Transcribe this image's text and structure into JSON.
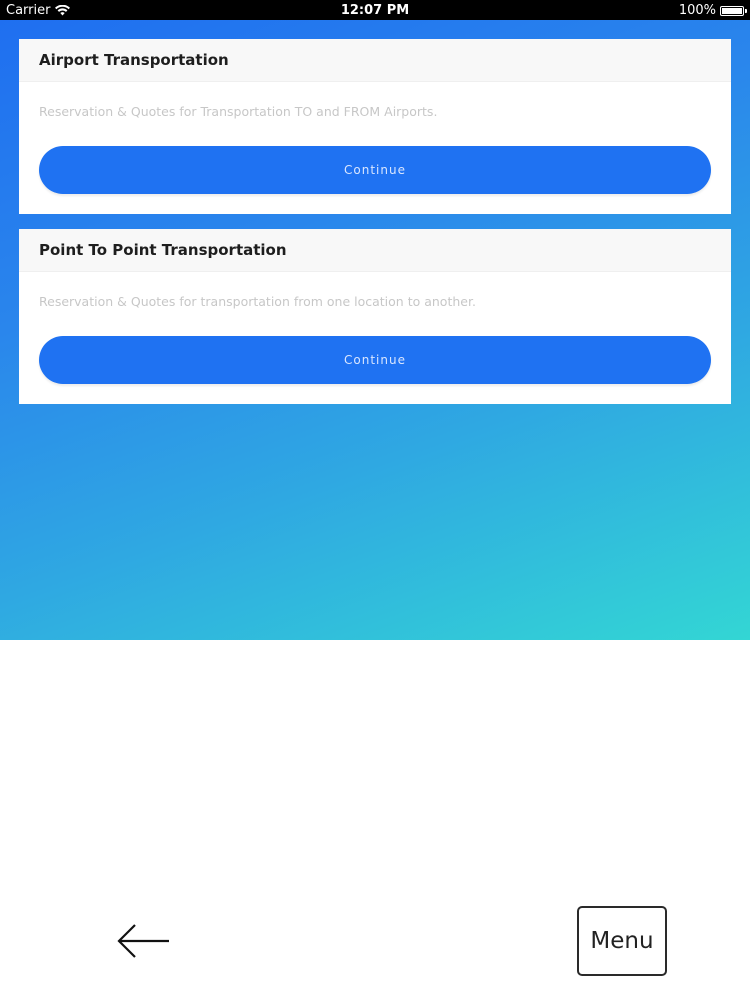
{
  "status_bar": {
    "carrier": "Carrier",
    "time": "12:07 PM",
    "battery": "100%"
  },
  "cards": [
    {
      "title": "Airport Transportation",
      "description": "Reservation & Quotes for Transportation TO and FROM Airports.",
      "button_label": "Continue"
    },
    {
      "title": "Point To Point Transportation",
      "description": "Reservation & Quotes for transportation from one location to another.",
      "button_label": "Continue"
    }
  ],
  "bottom_nav": {
    "back_icon": "arrow-left-icon",
    "menu_label": "Menu"
  },
  "colors": {
    "accent": "#1f72f2",
    "gradient_start": "#1f6ff0",
    "gradient_end": "#33d6d4"
  }
}
